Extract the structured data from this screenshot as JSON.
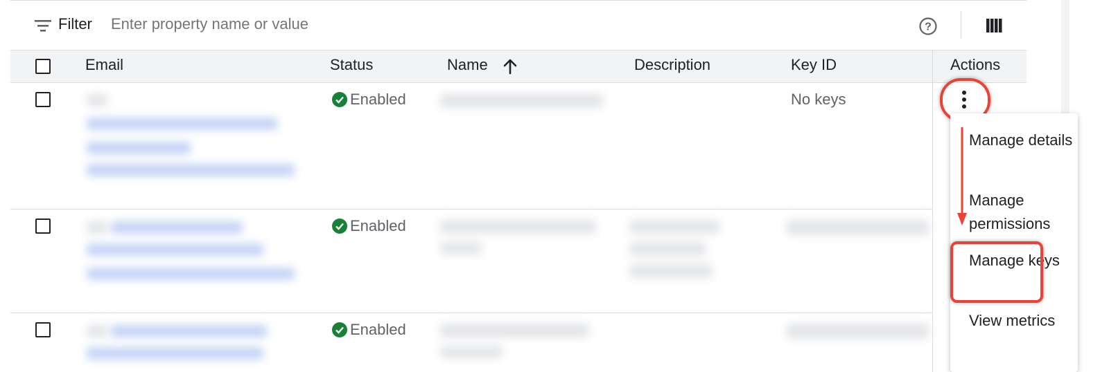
{
  "toolbar": {
    "filter_label": "Filter",
    "filter_placeholder": "Enter property name or value",
    "help_icon": "help-circle-icon",
    "columns_icon": "column-view-icon"
  },
  "table": {
    "columns": [
      "Email",
      "Status",
      "Name",
      "Description",
      "Key ID",
      "Actions"
    ],
    "sort": {
      "column": "Name",
      "direction": "ascending"
    },
    "rows": [
      {
        "status": "Enabled",
        "key_id": "No keys"
      },
      {
        "status": "Enabled",
        "key_id": ""
      },
      {
        "status": "Enabled",
        "key_id": ""
      }
    ]
  },
  "actions_menu": {
    "items": [
      "Manage details",
      "Manage permissions",
      "Manage keys",
      "View metrics"
    ],
    "highlighted_item": "Manage keys"
  },
  "colors": {
    "status_enabled": "#188038",
    "annotation": "#ea4335",
    "header_bg": "#f1f3f4"
  }
}
